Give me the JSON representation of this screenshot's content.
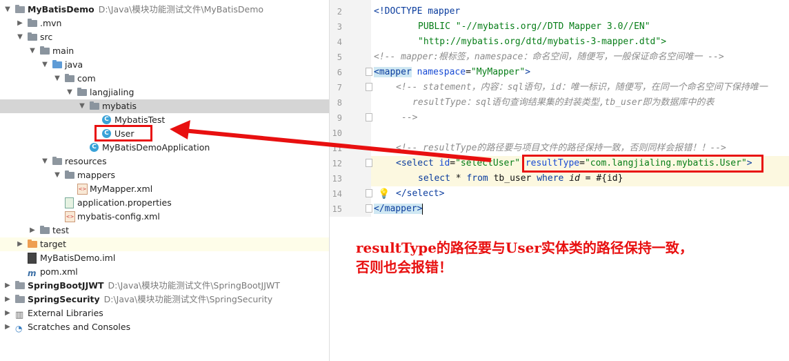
{
  "project_tree": {
    "root": {
      "name": "MyBatisDemo",
      "path": "D:\\Java\\模块功能测试文件\\MyBatisDemo"
    },
    "items": [
      {
        "label": ".mvn"
      },
      {
        "label": "src"
      },
      {
        "label": "main"
      },
      {
        "label": "java"
      },
      {
        "label": "com"
      },
      {
        "label": "langjialing"
      },
      {
        "label": "mybatis"
      },
      {
        "label": "MybatisTest"
      },
      {
        "label": "User"
      },
      {
        "label": "MyBatisDemoApplication"
      },
      {
        "label": "resources"
      },
      {
        "label": "mappers"
      },
      {
        "label": "MyMapper.xml"
      },
      {
        "label": "application.properties"
      },
      {
        "label": "mybatis-config.xml"
      },
      {
        "label": "test"
      },
      {
        "label": "target"
      },
      {
        "label": "MyBatisDemo.iml"
      },
      {
        "label": "pom.xml"
      }
    ],
    "other_projects": [
      {
        "name": "SpringBootJJWT",
        "path": "D:\\Java\\模块功能测试文件\\SpringBootJJWT"
      },
      {
        "name": "SpringSecurity",
        "path": "D:\\Java\\模块功能测试文件\\SpringSecurity"
      }
    ],
    "external_libraries": "External Libraries",
    "scratches": "Scratches and Consoles"
  },
  "editor": {
    "line_numbers": [
      "2",
      "3",
      "4",
      "5",
      "6",
      "7",
      "8",
      "9",
      "10",
      "11",
      "12",
      "13",
      "14",
      "15"
    ],
    "lines": {
      "l2": "<!DOCTYPE mapper",
      "l3": "PUBLIC \"-//mybatis.org//DTD Mapper 3.0//EN\"",
      "l4": "\"http://mybatis.org/dtd/mybatis-3-mapper.dtd\">",
      "l5": "<!-- mapper:根标签，namespace：命名空间，随便写，一般保证命名空间唯一 -->",
      "l6_tag": "<mapper",
      "l6_attr": "namespace",
      "l6_val": "\"MyMapper\"",
      "l7": "<!-- statement，内容：sql语句，id：唯一标识，随便写，在同一个命名空间下保持唯一",
      "l8": "resultType：sql语句查询结果集的封装类型,tb_user即为数据库中的表",
      "l9": "-->",
      "l11": "<!-- resultType的路径要与项目文件的路径保持一致，否则同样会报错！！-->",
      "l12_open": "<select",
      "l12_id_attr": "id",
      "l12_id_val": "\"selectUser\"",
      "l12_rt_attr": "resultType",
      "l12_rt_val": "\"com.langjialing.mybatis.User\"",
      "l12_close": ">",
      "l13_kw1": "select",
      "l13_mid1": " * ",
      "l13_kw2": "from",
      "l13_mid2": " tb_user ",
      "l13_kw3": "where",
      "l13_sp": " ",
      "l13_id": "id",
      "l13_rest": " = #{id}",
      "l14": "</select>",
      "l15_open": "</mapper",
      "l15_close": ">"
    }
  },
  "annotation": {
    "line1": "resultType的路径要与User实体类的路径保持一致，",
    "line2": "否则也会报错！",
    "color": "#e81010"
  }
}
